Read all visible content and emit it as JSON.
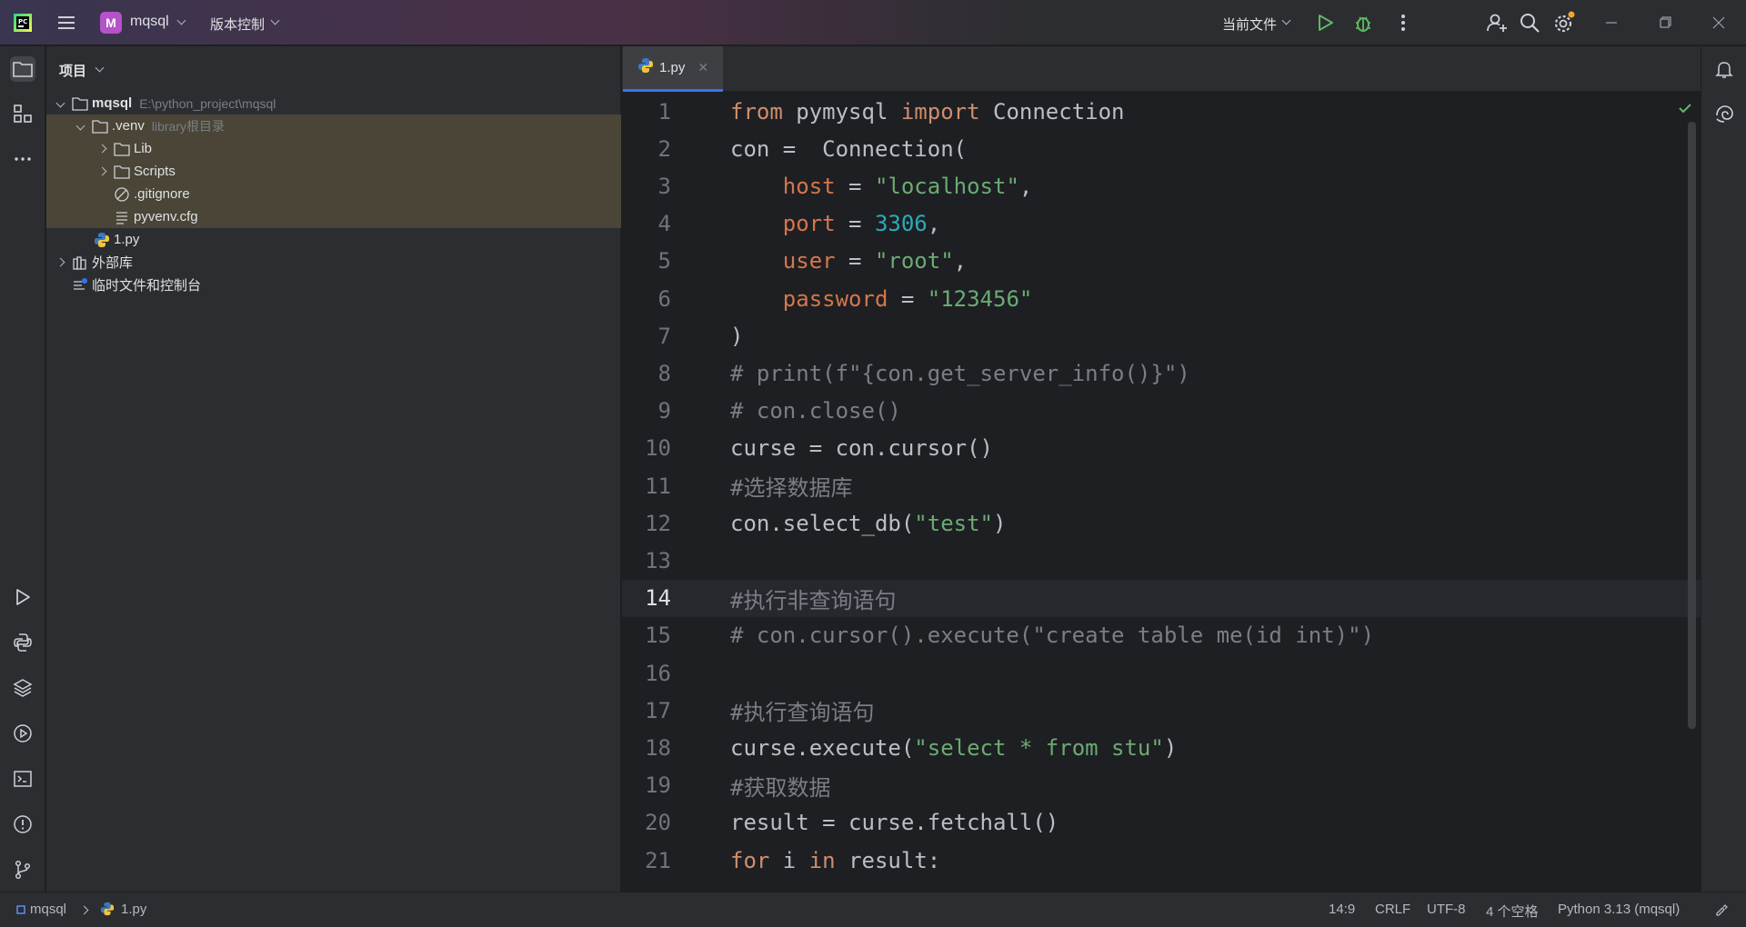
{
  "titlebar": {
    "project_badge": "M",
    "project_name": "mqsql",
    "vcs_label": "版本控制",
    "run_config_label": "当前文件"
  },
  "project_panel": {
    "header": "项目",
    "tree": [
      {
        "label": "mqsql",
        "hint": "E:\\python_project\\mqsql"
      },
      {
        "label": ".venv",
        "hint": "library根目录"
      },
      {
        "label": "Lib"
      },
      {
        "label": "Scripts"
      },
      {
        "label": ".gitignore"
      },
      {
        "label": "pyvenv.cfg"
      },
      {
        "label": "1.py"
      },
      {
        "label": "外部库"
      },
      {
        "label": "临时文件和控制台"
      }
    ]
  },
  "editor": {
    "tab_label": "1.py",
    "current_line": 14,
    "lines": [
      {
        "n": "1",
        "text": "from pymysql import Connection"
      },
      {
        "n": "2",
        "text": "con =  Connection("
      },
      {
        "n": "3",
        "text": "    host = \"localhost\","
      },
      {
        "n": "4",
        "text": "    port = 3306,"
      },
      {
        "n": "5",
        "text": "    user = \"root\","
      },
      {
        "n": "6",
        "text": "    password = \"123456\""
      },
      {
        "n": "7",
        "text": ")"
      },
      {
        "n": "8",
        "text": "# print(f\"{con.get_server_info()}\")"
      },
      {
        "n": "9",
        "text": "# con.close()"
      },
      {
        "n": "10",
        "text": "curse = con.cursor()"
      },
      {
        "n": "11",
        "text": "#选择数据库"
      },
      {
        "n": "12",
        "text": "con.select_db(\"test\")"
      },
      {
        "n": "13",
        "text": ""
      },
      {
        "n": "14",
        "text": "#执行非查询语句"
      },
      {
        "n": "15",
        "text": "# con.cursor().execute(\"create table me(id int)\")"
      },
      {
        "n": "16",
        "text": ""
      },
      {
        "n": "17",
        "text": "#执行查询语句"
      },
      {
        "n": "18",
        "text": "curse.execute(\"select * from stu\")"
      },
      {
        "n": "19",
        "text": "#获取数据"
      },
      {
        "n": "20",
        "text": "result = curse.fetchall()"
      },
      {
        "n": "21",
        "text": "for i in result:"
      }
    ]
  },
  "statusbar": {
    "breadcrumb_project": "mqsql",
    "breadcrumb_file": "1.py",
    "position": "14:9",
    "line_ending": "CRLF",
    "encoding": "UTF-8",
    "indent": "4 个空格",
    "interpreter": "Python 3.13 (mqsql)"
  },
  "colors": {
    "keyword": "#cf8e6d",
    "string": "#6aab73",
    "number": "#2aacb8",
    "comment": "#7a7e85",
    "named_arg": "#d5764d",
    "accent": "#3574f0",
    "excluded_bg": "#4a4536"
  }
}
